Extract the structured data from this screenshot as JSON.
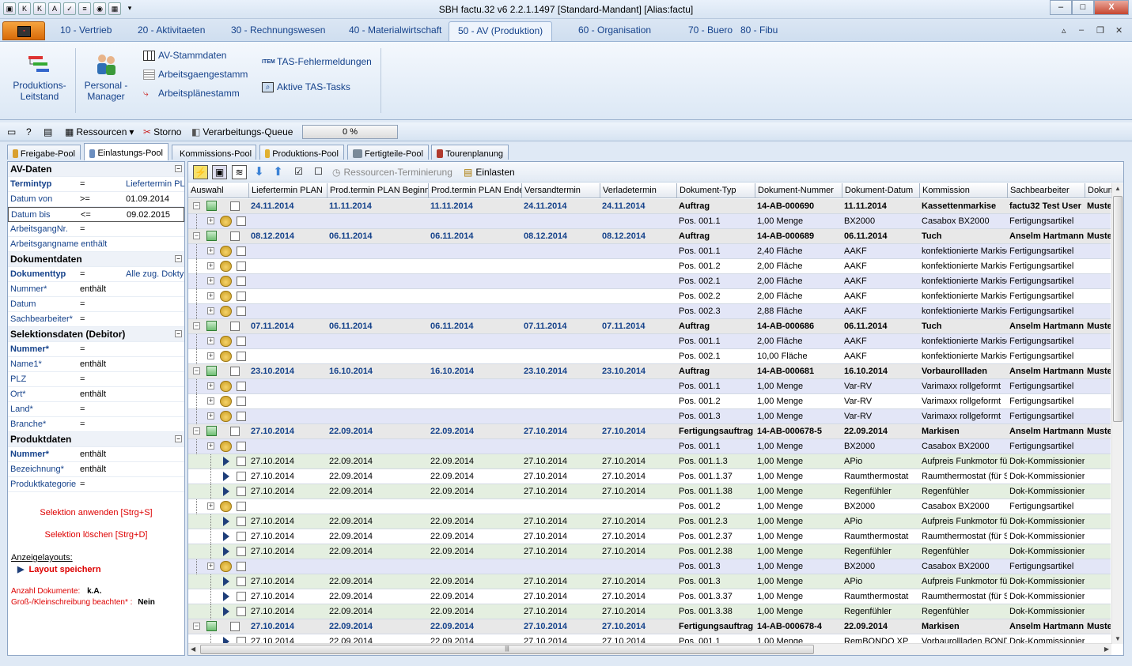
{
  "window": {
    "title": "SBH factu.32 v6 2.2.1.1497 [Standard-Mandant] [Alias:factu]",
    "min": "‒",
    "max": "□",
    "close": "X"
  },
  "ribbon_tabs": [
    "10 - Vertrieb",
    "20 - Aktivitaeten",
    "30 - Rechnungswesen",
    "40 - Materialwirtschaft",
    "50 - AV (Produktion)",
    "60 - Organisation",
    "70 - Buero",
    "80 - Fibu"
  ],
  "ribbon": {
    "produktions_leitstand": [
      "Produktions-",
      "Leitstand"
    ],
    "personal_manager": [
      "Personal -",
      "Manager"
    ],
    "av_stammdaten": "AV-Stammdaten",
    "arbeitsgaenge": "Arbeitsgaengestamm",
    "arbeitsplaene": "Arbeitsplänestamm",
    "tas_fehler": "TAS-Fehlermeldungen",
    "tas_tasks": "Aktive TAS-Tasks"
  },
  "toolbar": {
    "ressourcen": "Ressourcen",
    "storno": "Storno",
    "queue": "Verarbeitungs-Queue",
    "progress_text": "0 %",
    "progress": 0
  },
  "pool_tabs": [
    "Freigabe-Pool",
    "Einlastungs-Pool",
    "Kommissions-Pool",
    "Produktions-Pool",
    "Fertigteile-Pool",
    "Tourenplanung"
  ],
  "left": {
    "sections": [
      {
        "title": "AV-Daten",
        "rows": [
          {
            "label": "Termintyp",
            "op": "=",
            "value": "Liefertermin PLAN",
            "style": "b"
          },
          {
            "label": "Datum von",
            "op": ">=",
            "value": "01.09.2014",
            "style": "n"
          },
          {
            "label": "Datum bis",
            "op": "<=",
            "value": "09.02.2015",
            "style": "n",
            "sel": true
          },
          {
            "label": "ArbeitsgangNr.",
            "op": "=",
            "value": "",
            "style": "n"
          },
          {
            "label": "Arbeitsgangname enthält",
            "op": "",
            "value": "",
            "style": "n"
          }
        ]
      },
      {
        "title": "Dokumentdaten",
        "rows": [
          {
            "label": "Dokumenttyp",
            "op": "=",
            "value": "Alle zug. Doktypen",
            "style": "b"
          },
          {
            "label": "Nummer*",
            "op": "enthält",
            "value": "",
            "style": "n"
          },
          {
            "label": "Datum",
            "op": "=",
            "value": "",
            "style": "n"
          },
          {
            "label": "Sachbearbeiter*",
            "op": "=",
            "value": "",
            "style": "n"
          }
        ]
      },
      {
        "title": "Selektionsdaten (Debitor)",
        "rows": [
          {
            "label": "Nummer*",
            "op": "=",
            "value": "",
            "style": "b"
          },
          {
            "label": "Name1*",
            "op": "enthält",
            "value": "",
            "style": "n"
          },
          {
            "label": "PLZ",
            "op": "=",
            "value": "",
            "style": "n"
          },
          {
            "label": "Ort*",
            "op": "enthält",
            "value": "",
            "style": "n"
          },
          {
            "label": "Land*",
            "op": "=",
            "value": "",
            "style": "n"
          },
          {
            "label": "Branche*",
            "op": "=",
            "value": "",
            "style": "n"
          }
        ]
      },
      {
        "title": "Produktdaten",
        "rows": [
          {
            "label": "Nummer*",
            "op": "enthält",
            "value": "",
            "style": "b"
          },
          {
            "label": "Bezeichnung*",
            "op": "enthält",
            "value": "",
            "style": "n"
          },
          {
            "label": "Produktkategorie",
            "op": "=",
            "value": "",
            "style": "n"
          }
        ]
      }
    ],
    "apply": "Selektion anwenden [Strg+S]",
    "clear": "Selektion löschen [Strg+D]",
    "layouts_label": "Anzeigelayouts:",
    "save_layout": "Layout speichern",
    "count_label": "Anzahl Dokumente:",
    "count_value": "k.A.",
    "case_label": "Groß-/Kleinschreibung beachten* :",
    "case_value": "Nein"
  },
  "grid_toolbar": {
    "ress_term": "Ressourcen-Terminierung",
    "einlasten": "Einlasten"
  },
  "columns": [
    "Auswahl",
    "Liefertermin PLAN",
    "Prod.termin PLAN Beginn",
    "Prod.termin PLAN Ende",
    "Versandtermin",
    "Verladetermin",
    "Dokument-Typ",
    "Dokument-Nummer",
    "Dokument-Datum",
    "Kommission",
    "Sachbearbeiter",
    "Dokument"
  ],
  "rows": [
    {
      "l": 0,
      "c": [
        "24.11.2014",
        "11.11.2014",
        "11.11.2014",
        "24.11.2014",
        "24.11.2014",
        "Auftrag",
        "14-AB-000690",
        "11.11.2014",
        "Kassettenmarkise",
        "factu32 Test User",
        "Muster"
      ]
    },
    {
      "l": 1,
      "c": [
        "",
        "",
        "",
        "",
        "",
        "Pos. 001.1",
        "1,00 Menge",
        "BX2000",
        "Casabox BX2000",
        "Fertigungsartikel",
        ""
      ]
    },
    {
      "l": 0,
      "c": [
        "08.12.2014",
        "06.11.2014",
        "06.11.2014",
        "08.12.2014",
        "08.12.2014",
        "Auftrag",
        "14-AB-000689",
        "06.11.2014",
        "Tuch",
        "Anselm Hartmann",
        "Muster"
      ]
    },
    {
      "l": 1,
      "c": [
        "",
        "",
        "",
        "",
        "",
        "Pos. 001.1",
        "2,40 Fläche",
        "AAKF",
        "konfektionierte Markise",
        "Fertigungsartikel",
        ""
      ]
    },
    {
      "l": 1,
      "c": [
        "",
        "",
        "",
        "",
        "",
        "Pos. 001.2",
        "2,00 Fläche",
        "AAKF",
        "konfektionierte Markise",
        "Fertigungsartikel",
        ""
      ]
    },
    {
      "l": 1,
      "c": [
        "",
        "",
        "",
        "",
        "",
        "Pos. 002.1",
        "2,00 Fläche",
        "AAKF",
        "konfektionierte Markise",
        "Fertigungsartikel",
        ""
      ]
    },
    {
      "l": 1,
      "c": [
        "",
        "",
        "",
        "",
        "",
        "Pos. 002.2",
        "2,00 Fläche",
        "AAKF",
        "konfektionierte Markise",
        "Fertigungsartikel",
        ""
      ]
    },
    {
      "l": 1,
      "c": [
        "",
        "",
        "",
        "",
        "",
        "Pos. 002.3",
        "2,88 Fläche",
        "AAKF",
        "konfektionierte Markise",
        "Fertigungsartikel",
        ""
      ]
    },
    {
      "l": 0,
      "c": [
        "07.11.2014",
        "06.11.2014",
        "06.11.2014",
        "07.11.2014",
        "07.11.2014",
        "Auftrag",
        "14-AB-000686",
        "06.11.2014",
        "Tuch",
        "Anselm Hartmann",
        "Muster"
      ]
    },
    {
      "l": 1,
      "c": [
        "",
        "",
        "",
        "",
        "",
        "Pos. 001.1",
        "2,00 Fläche",
        "AAKF",
        "konfektionierte Markise",
        "Fertigungsartikel",
        ""
      ]
    },
    {
      "l": 1,
      "c": [
        "",
        "",
        "",
        "",
        "",
        "Pos. 002.1",
        "10,00 Fläche",
        "AAKF",
        "konfektionierte Markise",
        "Fertigungsartikel",
        ""
      ]
    },
    {
      "l": 0,
      "c": [
        "23.10.2014",
        "16.10.2014",
        "16.10.2014",
        "23.10.2014",
        "23.10.2014",
        "Auftrag",
        "14-AB-000681",
        "16.10.2014",
        "Vorbaurollladen",
        "Anselm Hartmann",
        "Muster"
      ]
    },
    {
      "l": 1,
      "c": [
        "",
        "",
        "",
        "",
        "",
        "Pos. 001.1",
        "1,00 Menge",
        "Var-RV",
        "Varimaxx rollgeformt",
        "Fertigungsartikel",
        ""
      ]
    },
    {
      "l": 1,
      "c": [
        "",
        "",
        "",
        "",
        "",
        "Pos. 001.2",
        "1,00 Menge",
        "Var-RV",
        "Varimaxx rollgeformt",
        "Fertigungsartikel",
        ""
      ]
    },
    {
      "l": 1,
      "c": [
        "",
        "",
        "",
        "",
        "",
        "Pos. 001.3",
        "1,00 Menge",
        "Var-RV",
        "Varimaxx rollgeformt",
        "Fertigungsartikel",
        ""
      ]
    },
    {
      "l": 0,
      "c": [
        "27.10.2014",
        "22.09.2014",
        "22.09.2014",
        "27.10.2014",
        "27.10.2014",
        "Fertigungsauftrag",
        "14-AB-000678-5",
        "22.09.2014",
        "Markisen",
        "Anselm Hartmann",
        "Muster"
      ]
    },
    {
      "l": 1,
      "c": [
        "",
        "",
        "",
        "",
        "",
        "Pos. 001.1",
        "1,00 Menge",
        "BX2000",
        "Casabox BX2000",
        "Fertigungsartikel",
        ""
      ]
    },
    {
      "l": 2,
      "c": [
        "27.10.2014",
        "22.09.2014",
        "22.09.2014",
        "27.10.2014",
        "27.10.2014",
        "Pos. 001.1.3",
        "1,00 Menge",
        "APio",
        "Aufpreis Funkmotor für",
        "Dok-Kommissionierung",
        ""
      ]
    },
    {
      "l": 2,
      "c": [
        "27.10.2014",
        "22.09.2014",
        "22.09.2014",
        "27.10.2014",
        "27.10.2014",
        "Pos. 001.1.37",
        "1,00 Menge",
        "Raumthermostat",
        "Raumthermostat (für S",
        "Dok-Kommissionierung",
        ""
      ]
    },
    {
      "l": 2,
      "c": [
        "27.10.2014",
        "22.09.2014",
        "22.09.2014",
        "27.10.2014",
        "27.10.2014",
        "Pos. 001.1.38",
        "1,00 Menge",
        "Regenfühler",
        "Regenfühler",
        "Dok-Kommissionierung",
        ""
      ]
    },
    {
      "l": 1,
      "c": [
        "",
        "",
        "",
        "",
        "",
        "Pos. 001.2",
        "1,00 Menge",
        "BX2000",
        "Casabox BX2000",
        "Fertigungsartikel",
        ""
      ]
    },
    {
      "l": 2,
      "c": [
        "27.10.2014",
        "22.09.2014",
        "22.09.2014",
        "27.10.2014",
        "27.10.2014",
        "Pos. 001.2.3",
        "1,00 Menge",
        "APio",
        "Aufpreis Funkmotor für",
        "Dok-Kommissionierung",
        ""
      ]
    },
    {
      "l": 2,
      "c": [
        "27.10.2014",
        "22.09.2014",
        "22.09.2014",
        "27.10.2014",
        "27.10.2014",
        "Pos. 001.2.37",
        "1,00 Menge",
        "Raumthermostat",
        "Raumthermostat (für S",
        "Dok-Kommissionierung",
        ""
      ]
    },
    {
      "l": 2,
      "c": [
        "27.10.2014",
        "22.09.2014",
        "22.09.2014",
        "27.10.2014",
        "27.10.2014",
        "Pos. 001.2.38",
        "1,00 Menge",
        "Regenfühler",
        "Regenfühler",
        "Dok-Kommissionierung",
        ""
      ]
    },
    {
      "l": 1,
      "c": [
        "",
        "",
        "",
        "",
        "",
        "Pos. 001.3",
        "1,00 Menge",
        "BX2000",
        "Casabox BX2000",
        "Fertigungsartikel",
        ""
      ]
    },
    {
      "l": 2,
      "c": [
        "27.10.2014",
        "22.09.2014",
        "22.09.2014",
        "27.10.2014",
        "27.10.2014",
        "Pos. 001.3",
        "1,00 Menge",
        "APio",
        "Aufpreis Funkmotor für",
        "Dok-Kommissionierung",
        ""
      ]
    },
    {
      "l": 2,
      "c": [
        "27.10.2014",
        "22.09.2014",
        "22.09.2014",
        "27.10.2014",
        "27.10.2014",
        "Pos. 001.3.37",
        "1,00 Menge",
        "Raumthermostat",
        "Raumthermostat (für S",
        "Dok-Kommissionierung",
        ""
      ]
    },
    {
      "l": 2,
      "c": [
        "27.10.2014",
        "22.09.2014",
        "22.09.2014",
        "27.10.2014",
        "27.10.2014",
        "Pos. 001.3.38",
        "1,00 Menge",
        "Regenfühler",
        "Regenfühler",
        "Dok-Kommissionierung",
        ""
      ]
    },
    {
      "l": 0,
      "c": [
        "27.10.2014",
        "22.09.2014",
        "22.09.2014",
        "27.10.2014",
        "27.10.2014",
        "Fertigungsauftrag",
        "14-AB-000678-4",
        "22.09.2014",
        "Markisen",
        "Anselm Hartmann",
        "Muster"
      ]
    },
    {
      "l": 2,
      "c": [
        "27.10.2014",
        "22.09.2014",
        "22.09.2014",
        "27.10.2014",
        "27.10.2014",
        "Pos. 001.1",
        "1,00 Menge",
        "RemBONDO XP",
        "Vorbaurollladen BOND",
        "Dok-Kommissionierung",
        ""
      ]
    }
  ]
}
